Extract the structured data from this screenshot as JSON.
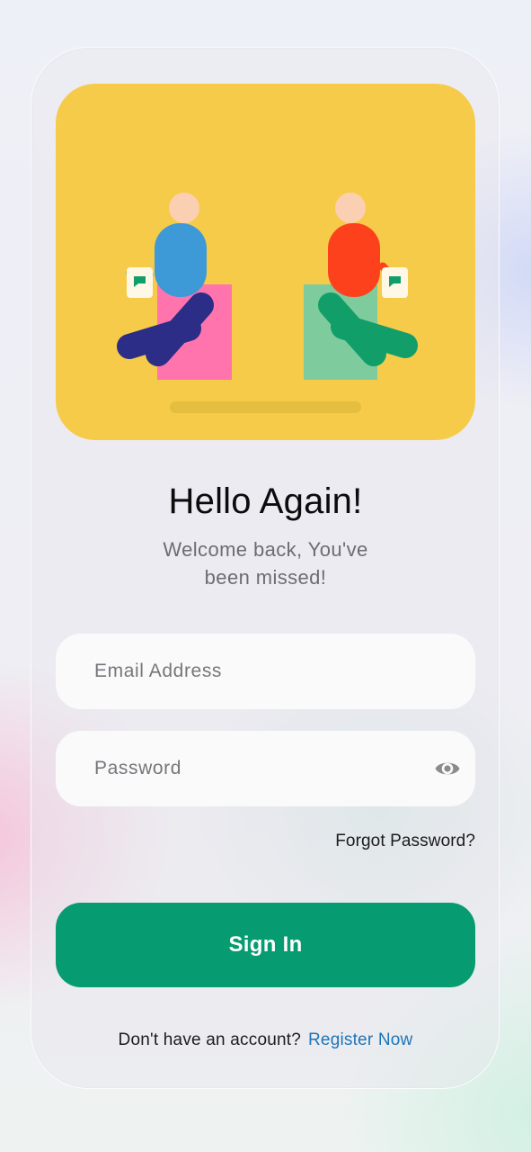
{
  "hero": {
    "illustration": "two-people-chatting-illustration",
    "colors": {
      "background": "#f6cb49",
      "left_person_body": "#3d9ad6",
      "left_person_legs": "#2b2d87",
      "left_box": "#ff74ad",
      "right_person_body": "#fd411c",
      "right_person_legs": "#119e69",
      "right_box": "#7ecb9e",
      "head": "#fbcfb1"
    }
  },
  "login": {
    "title": "Hello Again!",
    "subtitle": "Welcome back, You've been missed!",
    "email_placeholder": "Email Address",
    "password_placeholder": "Password",
    "show_password_icon": "eye-icon",
    "forgot_label": "Forgot Password?",
    "signin_label": "Sign In"
  },
  "footer": {
    "question": "Don't have an account?",
    "register_label": "Register Now"
  },
  "theme": {
    "accent": "#069b70",
    "link": "#1e74b8"
  }
}
